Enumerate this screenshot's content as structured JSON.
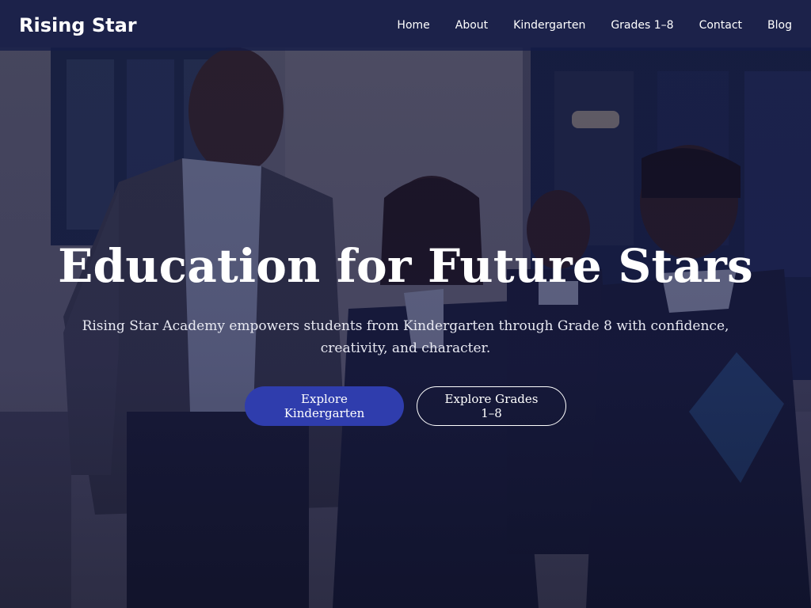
{
  "nav": {
    "brand": "Rising Star",
    "links": [
      "Home",
      "About",
      "Kindergarten",
      "Grades 1–8",
      "Contact",
      "Blog"
    ]
  },
  "hero": {
    "headline": "Education for Future Stars",
    "subtitle": "Rising Star Academy empowers students from Kindergarten through Grade 8 with confidence, creativity, and character.",
    "primary_button": "Explore Kindergarten",
    "secondary_button": "Explore Grades 1–8"
  },
  "colors": {
    "navbar": "#141c48",
    "primary_button": "#2f3dad",
    "text": "#ffffff"
  }
}
